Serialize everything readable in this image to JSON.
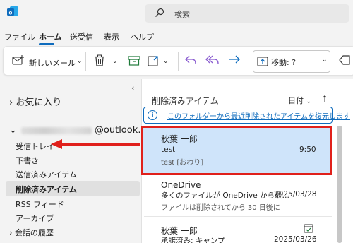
{
  "search": {
    "placeholder": "検索"
  },
  "menu": {
    "items": [
      "ファイル",
      "ホーム",
      "送受信",
      "表示",
      "ヘルプ"
    ]
  },
  "toolbar": {
    "new_mail_label": "新しいメール",
    "move_label": "移動: ?"
  },
  "sidebar": {
    "favorites_label": "お気に入り",
    "account_domain": "@outlook…",
    "folders": [
      "受信トレイ",
      "下書き",
      "送信済みアイテム",
      "削除済みアイテム",
      "RSS フィード",
      "アーカイブ",
      "会話の履歴"
    ]
  },
  "list": {
    "title": "削除済みアイテム",
    "sort_label": "日付",
    "info_link": "このフォルダーから最近削除されたアイテムを復元します",
    "messages": [
      {
        "sender": "秋葉 一郎",
        "subject": "test",
        "preview": "test [おわり]",
        "date": "9:50"
      },
      {
        "sender": "OneDrive",
        "subject": "多くのファイルが OneDrive から最…",
        "preview": "ファイルは削除されてから 30 日後に",
        "date": "2025/03/28"
      },
      {
        "sender": "秋葉 一郎",
        "subject": "承諾済み: キャンプ",
        "preview": "",
        "date": "2025/03/26"
      }
    ]
  },
  "colors": {
    "accent": "#0f6cbd",
    "highlight": "#e0201b",
    "selected_bg": "#cfe4fa"
  }
}
